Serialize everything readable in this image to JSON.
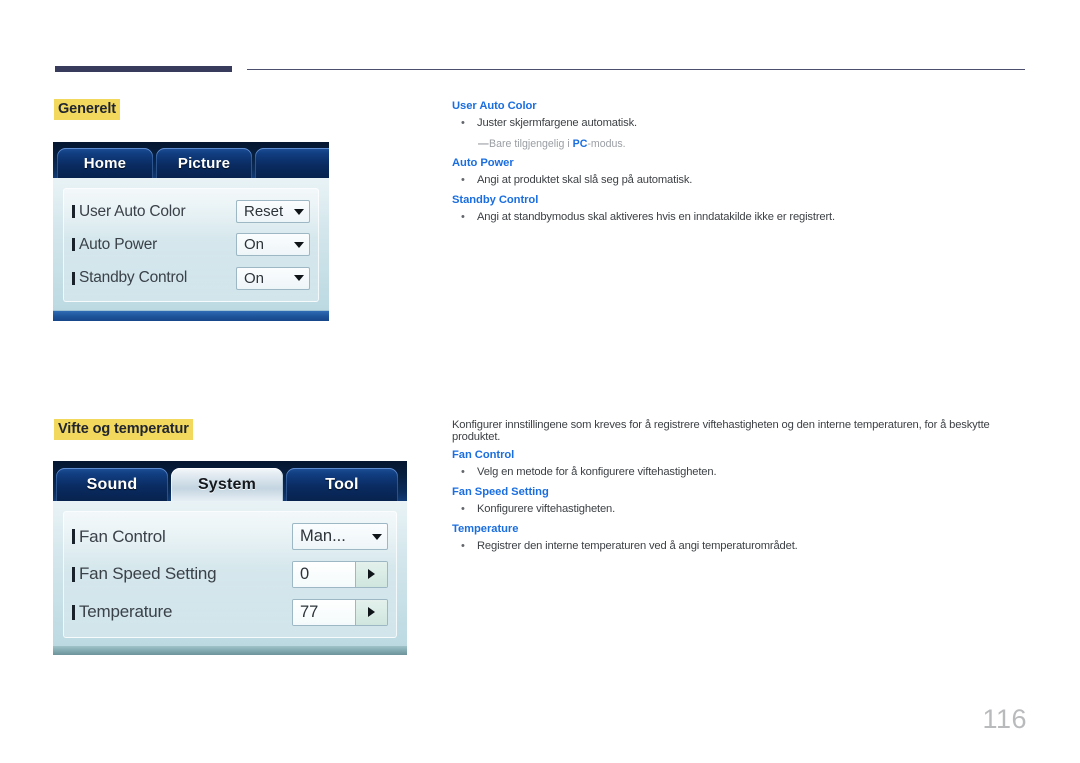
{
  "page": {
    "number": "116"
  },
  "sections": [
    {
      "title": "Generelt",
      "osd": {
        "tabs": [
          {
            "label": "Home",
            "active": false
          },
          {
            "label": "Picture",
            "active": false
          }
        ],
        "rows": [
          {
            "label": "User Auto Color",
            "value": "Reset",
            "control": "dropdown"
          },
          {
            "label": "Auto Power",
            "value": "On",
            "control": "dropdown"
          },
          {
            "label": "Standby Control",
            "value": "On",
            "control": "dropdown"
          }
        ]
      },
      "text": {
        "blocks": [
          {
            "head": "User Auto Color",
            "bullet": "Juster skjermfargene automatisk.",
            "note_pre": "Bare tilgjengelig i ",
            "note_bold": "PC",
            "note_post": "-modus."
          },
          {
            "head": "Auto Power",
            "bullet": "Angi at produktet skal slå seg på automatisk."
          },
          {
            "head": "Standby Control",
            "bullet": "Angi at standbymodus skal aktiveres hvis en inndatakilde ikke er registrert."
          }
        ]
      }
    },
    {
      "title": "Vifte og temperatur",
      "osd": {
        "tabs": [
          {
            "label": "Sound",
            "active": false
          },
          {
            "label": "System",
            "active": true
          },
          {
            "label": "Tool",
            "active": false
          }
        ],
        "rows": [
          {
            "label": "Fan Control",
            "value": "Man...",
            "control": "dropdown"
          },
          {
            "label": "Fan Speed Setting",
            "value": "0",
            "control": "stepper"
          },
          {
            "label": "Temperature",
            "value": "77",
            "control": "stepper"
          }
        ]
      },
      "text": {
        "intro": "Konfigurer innstillingene som kreves for å registrere viftehastigheten og den interne temperaturen, for å beskytte produktet.",
        "blocks": [
          {
            "head": "Fan Control",
            "bullet": "Velg en metode for å konfigurere viftehastigheten."
          },
          {
            "head": "Fan Speed Setting",
            "bullet": "Konfigurere viftehastigheten."
          },
          {
            "head": "Temperature",
            "bullet": "Registrer den interne temperaturen ved å angi temperaturområdet."
          }
        ]
      }
    }
  ],
  "colors": {
    "heading_blue": "#1a6ee0",
    "highlight_yellow": "#f2d85c",
    "rule_navy": "#383b5c"
  }
}
